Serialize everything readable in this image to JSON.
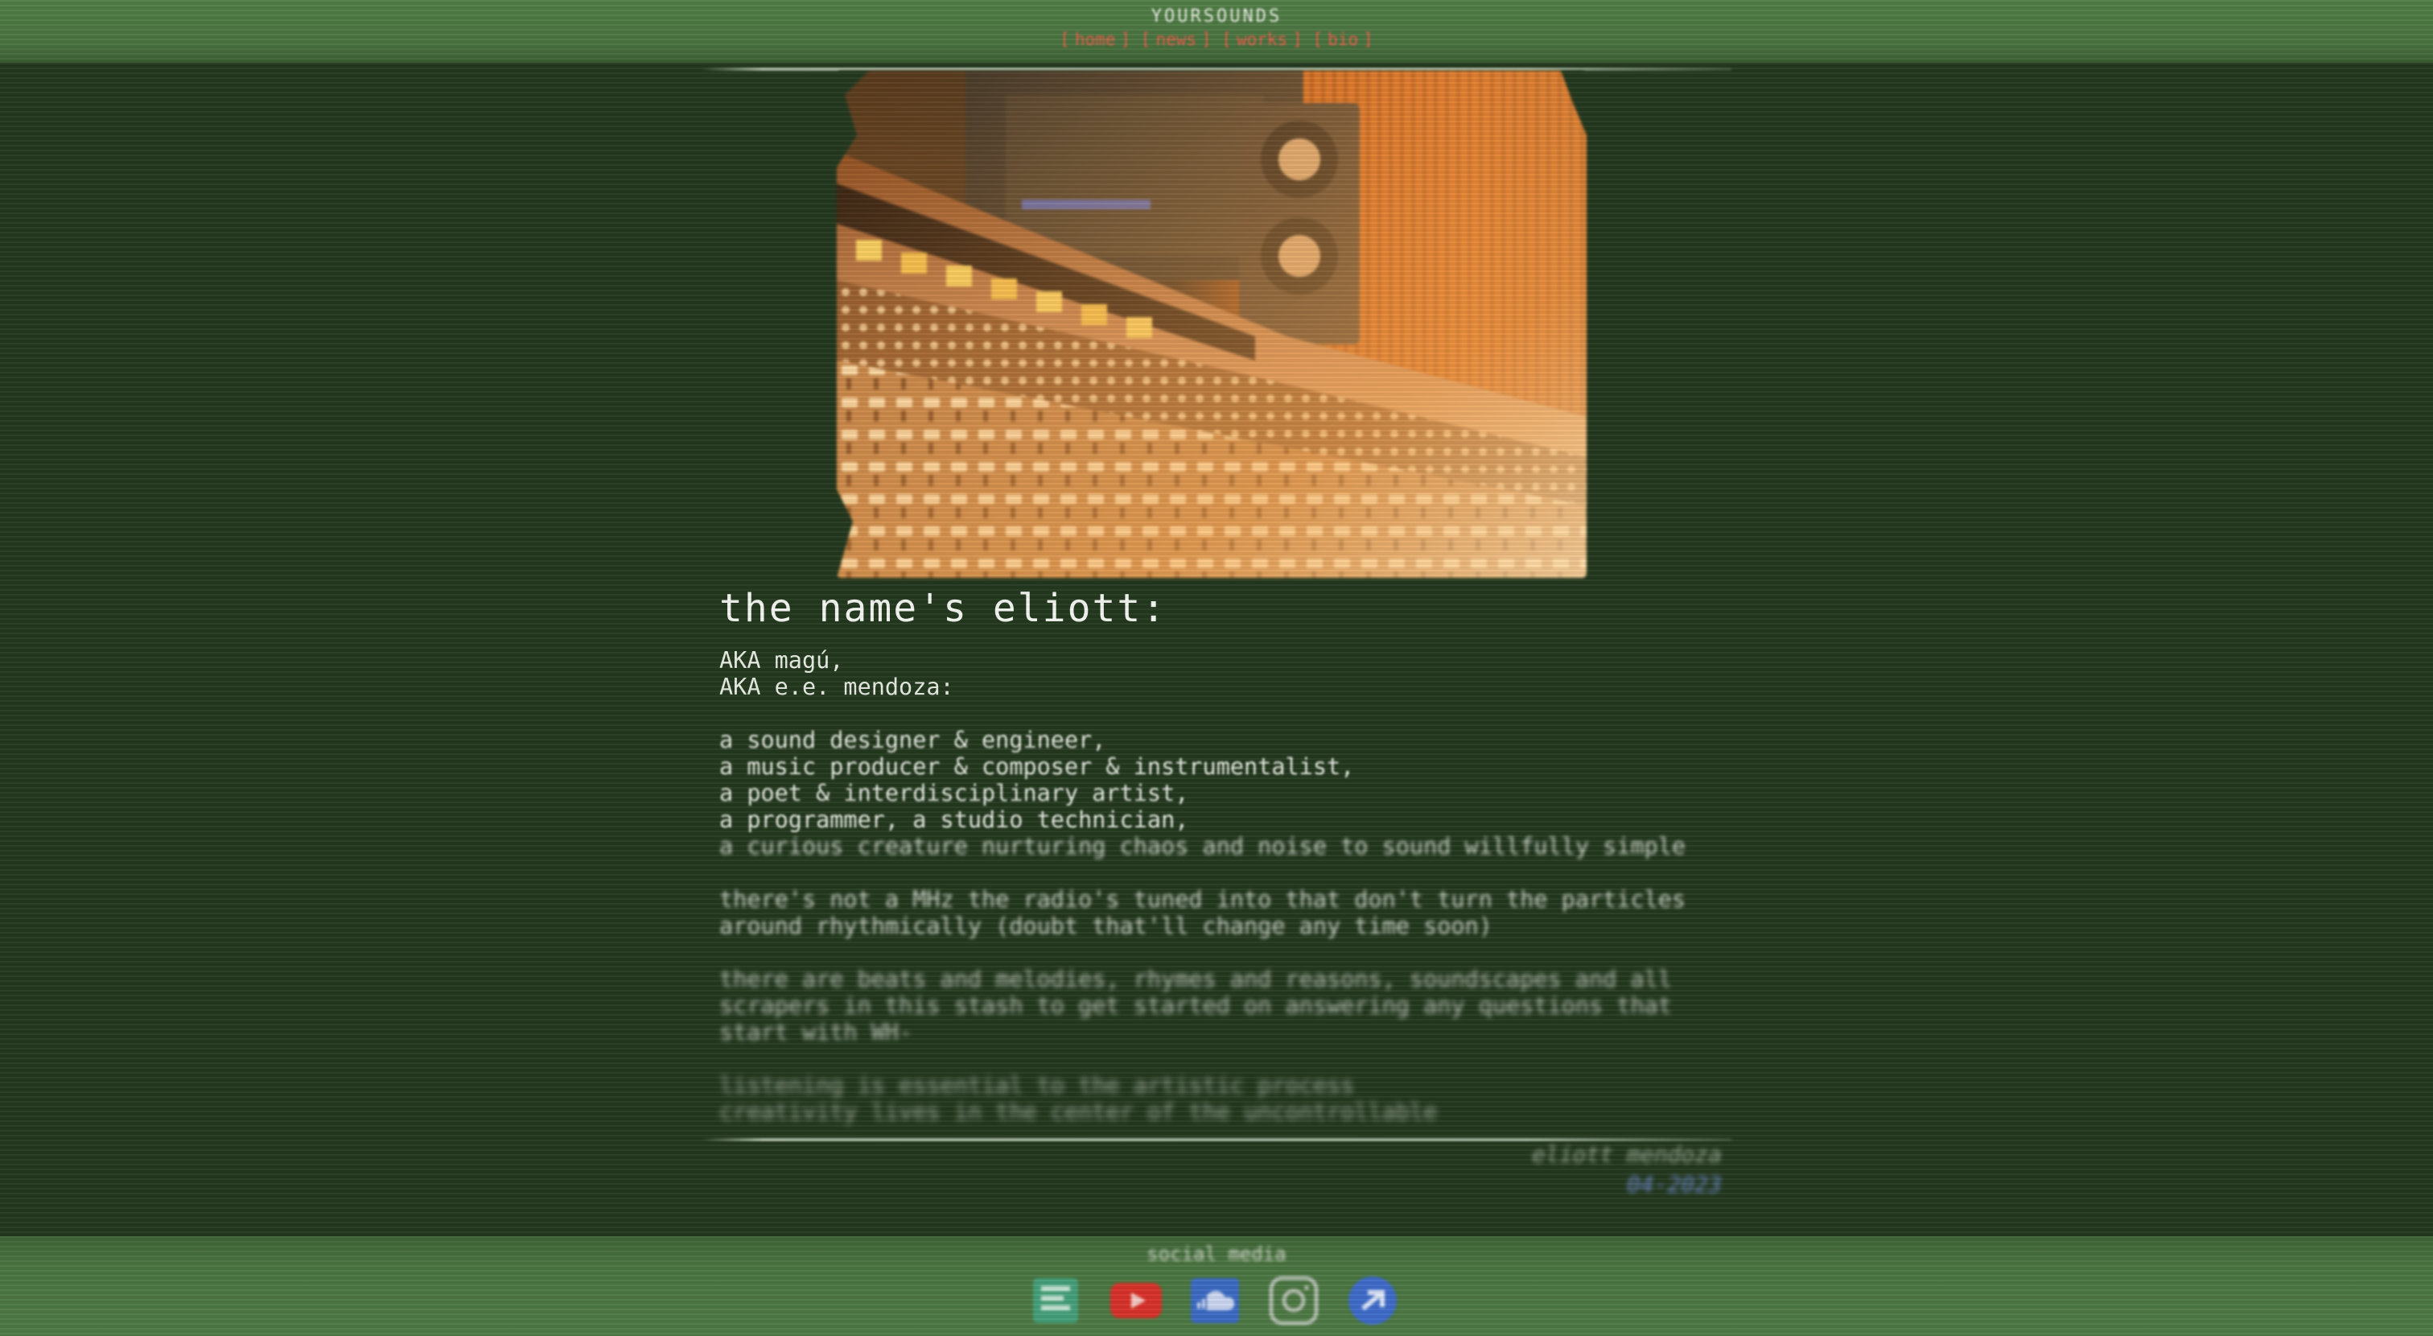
{
  "header": {
    "site_title": "YOURSOUNDS",
    "nav": [
      "home",
      "news",
      "works",
      "bio"
    ]
  },
  "intro": {
    "headline": "the name's eliott:",
    "aka_lines": [
      "AKA magú,",
      "AKA e.e. mendoza:"
    ],
    "roles": [
      "a sound designer & engineer,",
      "a music producer & composer & instrumentalist,",
      "a poet & interdisciplinary artist,",
      "a programmer, a studio technician,",
      "a curious creature nurturing chaos and noise to sound willfully simple"
    ],
    "paragraph_2": [
      "there's not a MHz the radio's tuned into that don't turn the particles",
      "around rhythmically (doubt that'll change any time soon)"
    ],
    "paragraph_3": [
      "there are beats and melodies, rhymes and reasons, soundscapes and all",
      "scrapers in this stash to get started on answering any questions that",
      "start with WH-"
    ],
    "paragraph_4": [
      "listening is essential to the artistic process",
      "creativity lives in the center of the uncontrollable"
    ]
  },
  "signature": {
    "who": "eliott mendoza",
    "date": "04-2023"
  },
  "footer": {
    "social_label": "social media",
    "icons": [
      "bandcamp-icon",
      "youtube-icon",
      "soundcloud-icon",
      "instagram-icon",
      "linktree-icon"
    ]
  },
  "colors": {
    "background": "#24391f",
    "bar_green": "#4e7a44",
    "nav_red": "#ee5d4c",
    "text": "#e8ece4"
  }
}
